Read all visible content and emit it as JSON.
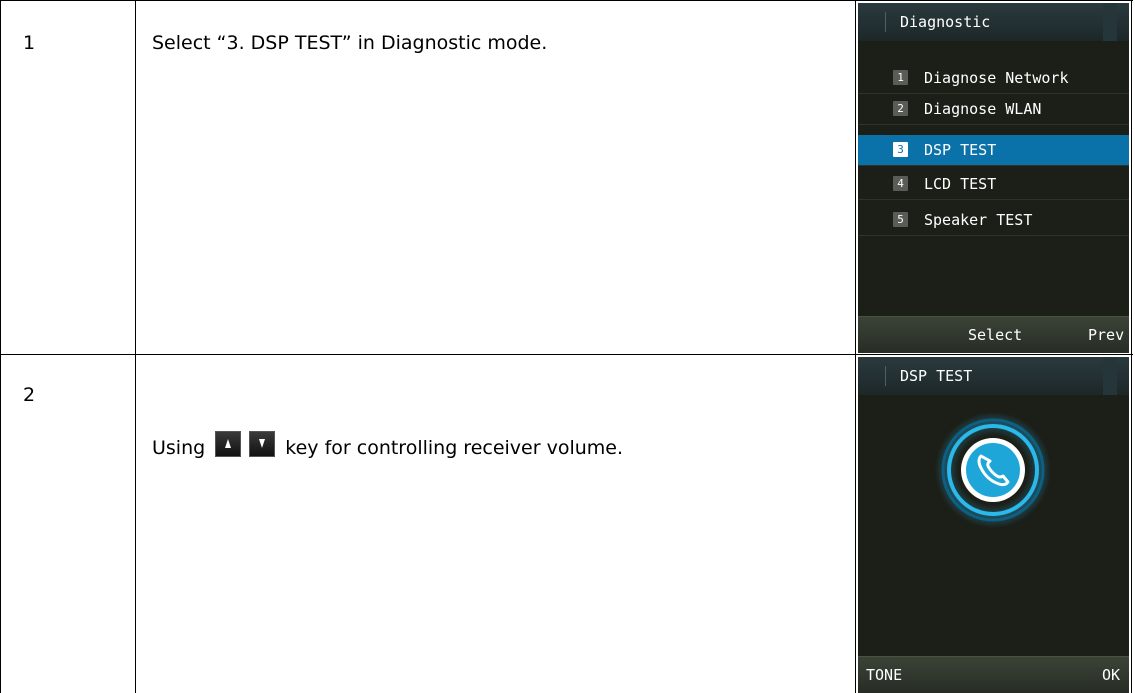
{
  "rows": [
    {
      "number": "1",
      "instruction": "Select “3. DSP TEST” in Diagnostic mode.",
      "screen": {
        "title": "Diagnostic",
        "items": [
          {
            "num": "1",
            "label": "Diagnose Network",
            "selected": false
          },
          {
            "num": "2",
            "label": "Diagnose WLAN",
            "selected": false
          },
          {
            "num": "3",
            "label": "DSP TEST",
            "selected": true
          },
          {
            "num": "4",
            "label": "LCD TEST",
            "selected": false
          },
          {
            "num": "5",
            "label": "Speaker TEST",
            "selected": false
          }
        ],
        "softkeys": {
          "left": "Select",
          "right": "Prev"
        }
      }
    },
    {
      "number": "2",
      "instruction_prefix": "Using",
      "instruction_suffix": "key for controlling receiver volume.",
      "keys": [
        "up-arrow-key-icon",
        "down-arrow-key-icon"
      ],
      "screen": {
        "title": "DSP TEST",
        "icon": "phone-ring-icon",
        "softkeys": {
          "left": "TONE",
          "right": "OK"
        }
      }
    }
  ],
  "colors": {
    "selection": "#0a72a8",
    "screen_bg": "#1c1f18",
    "ring": "#1fa6d8"
  }
}
